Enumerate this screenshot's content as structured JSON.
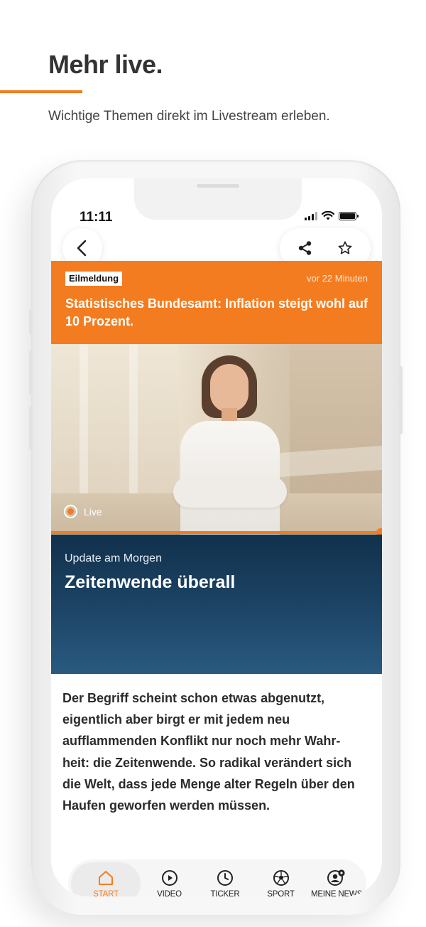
{
  "promo": {
    "title": "Mehr live.",
    "subtitle": "Wichtige Themen direkt im Livestream erleben."
  },
  "status_bar": {
    "time": "11:11"
  },
  "toolbar": {
    "back_icon": "chevron-left-icon",
    "share_icon": "share-icon",
    "favorite_icon": "star-outline-icon"
  },
  "breaking": {
    "badge": "Eilmeldung",
    "time": "vor 22 Minuten",
    "headline": "Statistisches Bundesamt: Inflation steigt wohl auf 10 Prozent."
  },
  "video": {
    "live_label": "Live",
    "progress": 1.0
  },
  "show": {
    "kicker": "Update am Morgen",
    "title": "Zeitenwende überall"
  },
  "article": {
    "text": "Der Begriff scheint schon etwas abgenutzt, eigentlich aber birgt er mit jedem neu aufflammenden Konflikt nur noch mehr Wahr-heit: die Zeitenwende. So radikal verändert sich die Welt, dass jede Menge alter Regeln über den Haufen geworfen werden müssen."
  },
  "tabbar": {
    "items": [
      {
        "label": "START",
        "icon": "home-icon",
        "active": true
      },
      {
        "label": "VIDEO",
        "icon": "play-circle-icon",
        "active": false
      },
      {
        "label": "TICKER",
        "icon": "clock-icon",
        "active": false
      },
      {
        "label": "SPORT",
        "icon": "soccer-ball-icon",
        "active": false
      },
      {
        "label": "MEINE NEWS",
        "icon": "user-settings-icon",
        "active": false
      }
    ]
  },
  "colors": {
    "accent": "#f47c20",
    "show_bg": "#1d4567",
    "text": "#2b2b2b"
  }
}
